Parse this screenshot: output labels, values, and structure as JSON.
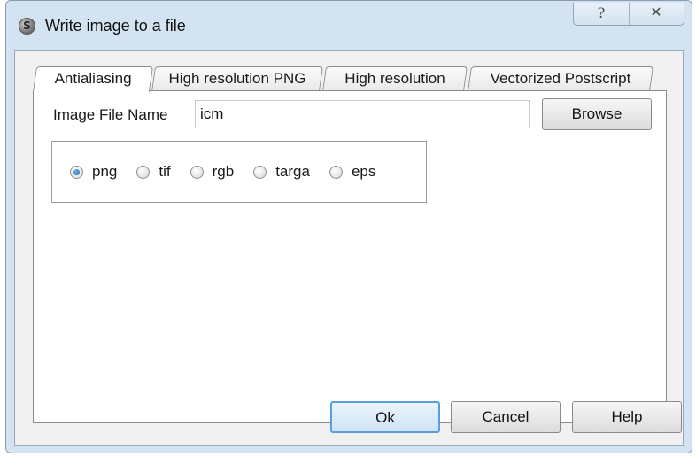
{
  "window": {
    "title": "Write image to a file",
    "app_icon": "S",
    "help_glyph": "?",
    "close_glyph": "✕"
  },
  "tabs": [
    {
      "label": "Antialiasing",
      "active": true
    },
    {
      "label": "High resolution PNG",
      "active": false
    },
    {
      "label": "High resolution",
      "active": false
    },
    {
      "label": "Vectorized Postscript",
      "active": false
    }
  ],
  "form": {
    "file_name_label": "Image File Name",
    "file_name_value": "icm",
    "browse_label": "Browse"
  },
  "formats": {
    "options": [
      "png",
      "tif",
      "rgb",
      "targa",
      "eps"
    ],
    "selected": "png"
  },
  "footer": {
    "ok_label": "Ok",
    "cancel_label": "Cancel",
    "help_label": "Help"
  },
  "colors": {
    "titlebar": "#d4e3f1",
    "client": "#f0f0f0",
    "default_button_border": "#57a0dd"
  },
  "icons": [
    "app-icon",
    "help-icon",
    "close-icon"
  ]
}
